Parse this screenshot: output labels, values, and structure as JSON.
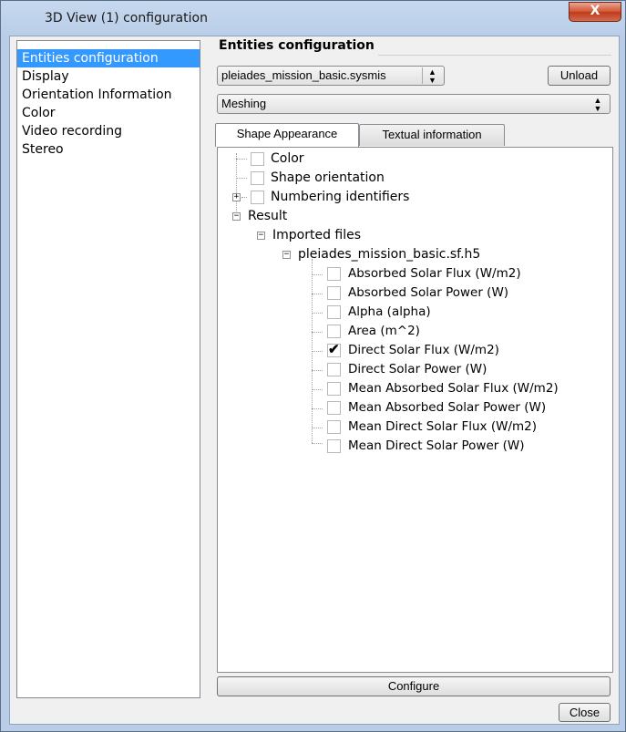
{
  "window": {
    "title": "3D View (1) configuration",
    "close_glyph": "X"
  },
  "sidebar": {
    "items": [
      {
        "label": "Entities configuration",
        "selected": true
      },
      {
        "label": "Display"
      },
      {
        "label": "Orientation Information"
      },
      {
        "label": "Color"
      },
      {
        "label": "Video recording"
      },
      {
        "label": "Stereo"
      }
    ]
  },
  "group": {
    "title": "Entities configuration"
  },
  "file_combo": {
    "value": "pleiades_mission_basic.sysmis"
  },
  "unload_button": {
    "label": "Unload"
  },
  "mode_combo": {
    "value": "Meshing"
  },
  "tabs": [
    {
      "label": "Shape Appearance",
      "active": true
    },
    {
      "label": "Textual information"
    }
  ],
  "tree": {
    "color": "Color",
    "shape_orientation": "Shape orientation",
    "numbering_identifiers": "Numbering identifiers",
    "result": "Result",
    "imported_files": "Imported files",
    "file": "pleiades_mission_basic.sf.h5",
    "results": [
      {
        "label": "Absorbed Solar Flux (W/m2)",
        "checked": false
      },
      {
        "label": "Absorbed Solar Power (W)",
        "checked": false
      },
      {
        "label": "Alpha (alpha)",
        "checked": false
      },
      {
        "label": "Area (m^2)",
        "checked": false
      },
      {
        "label": "Direct Solar Flux (W/m2)",
        "checked": true
      },
      {
        "label": "Direct Solar Power (W)",
        "checked": false
      },
      {
        "label": "Mean Absorbed Solar Flux (W/m2)",
        "checked": false
      },
      {
        "label": "Mean Absorbed Solar Power (W)",
        "checked": false
      },
      {
        "label": "Mean Direct Solar Flux (W/m2)",
        "checked": false
      },
      {
        "label": "Mean Direct Solar Power (W)",
        "checked": false
      }
    ]
  },
  "configure_button": {
    "label": "Configure"
  },
  "close_button": {
    "label": "Close"
  },
  "glyphs": {
    "check": "✔",
    "collapse": "−",
    "expand": "+"
  }
}
